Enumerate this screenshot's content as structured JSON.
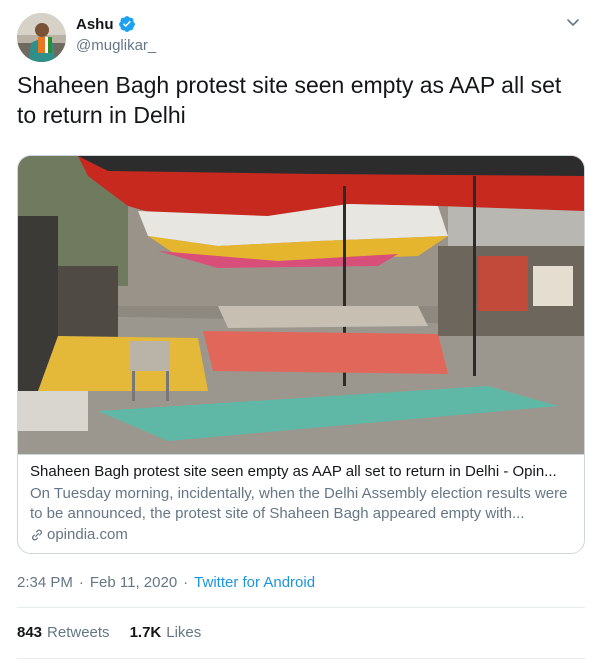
{
  "author": {
    "name": "Ashu",
    "handle": "@muglikar_",
    "verified": true
  },
  "tweet": {
    "text": "Shaheen Bagh protest site seen empty as AAP all set to return in Delhi"
  },
  "card": {
    "title": "Shaheen Bagh protest site seen empty as AAP all set to return in Delhi - Opin...",
    "description": "On Tuesday morning, incidentally, when the Delhi Assembly election results were to be announced, the protest site of Shaheen Bagh appeared empty with...",
    "domain": "opindia.com"
  },
  "meta": {
    "time": "2:34 PM",
    "separator": "·",
    "date": "Feb 11, 2020",
    "source": "Twitter for Android"
  },
  "stats": {
    "retweets_count": "843",
    "retweets_label": "Retweets",
    "likes_count": "1.7K",
    "likes_label": "Likes"
  },
  "colors": {
    "link_blue": "#1b95e0",
    "verified_blue": "#1da1f2",
    "secondary_text": "#657786",
    "border": "#ccd6dd"
  },
  "icons": {
    "verified": "verified-badge-icon",
    "caret": "chevron-down-icon",
    "link": "link-icon"
  }
}
